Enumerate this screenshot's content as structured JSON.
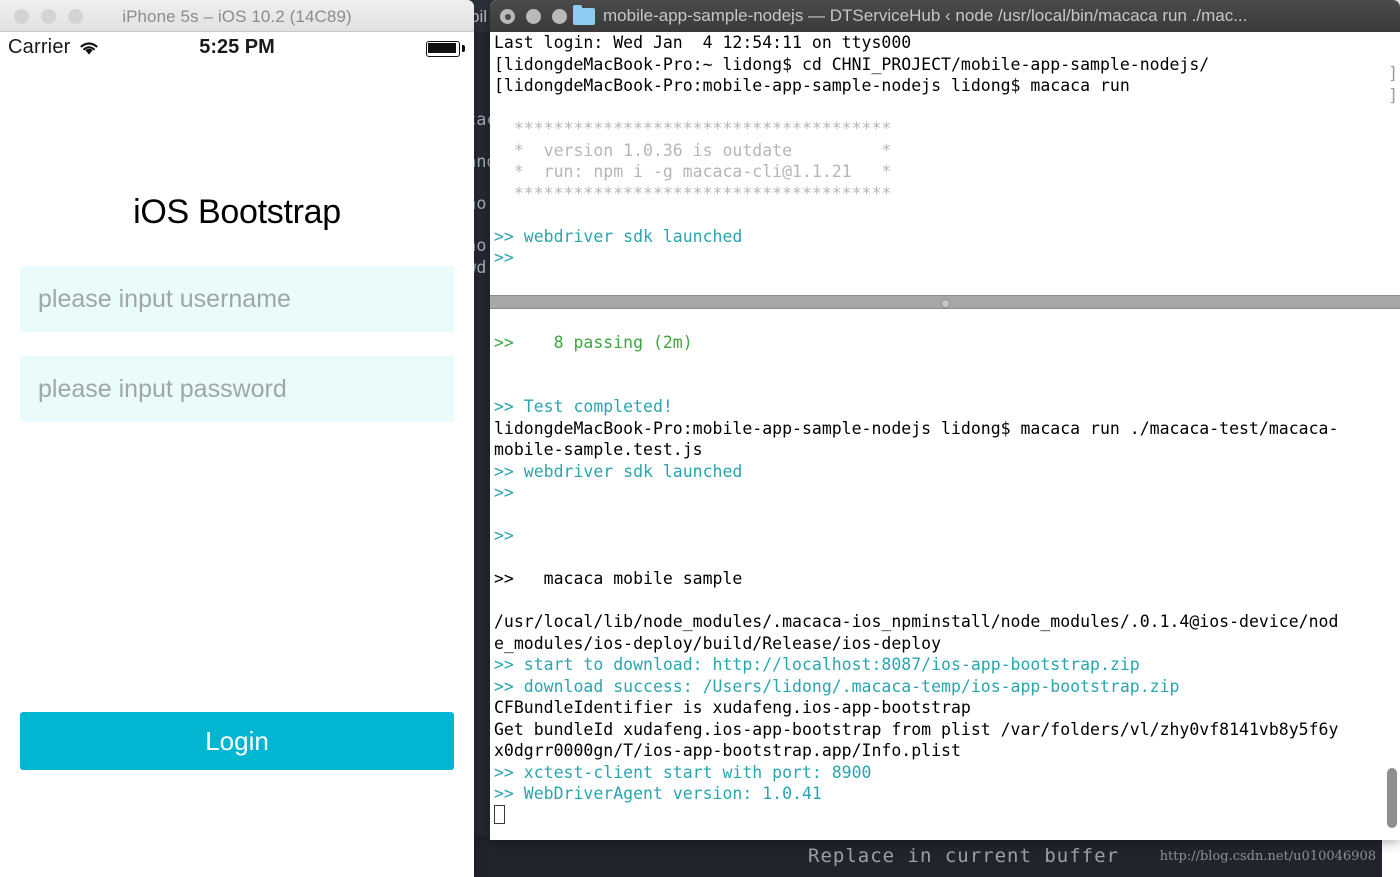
{
  "background_editor": {
    "title_fragment": "bil",
    "text_fragments": [
      "cac",
      "and",
      "no",
      "no",
      "wd"
    ],
    "status_text": "Replace in current buffer",
    "watermark": "http://blog.csdn.net/u010046908",
    "bg_color": "#272b33"
  },
  "simulator": {
    "window_title": "iPhone 5s – iOS 10.2 (14C89)",
    "traffic_lights": [
      "close-button",
      "minimize-button",
      "zoom-button"
    ],
    "status_bar": {
      "carrier": "Carrier",
      "wifi_icon": "wifi-icon",
      "time": "5:25 PM",
      "battery_icon": "battery-full-icon"
    },
    "app": {
      "title": "iOS Bootstrap",
      "username_placeholder": "please input username",
      "password_placeholder": "please input password",
      "username_value": "",
      "password_value": "",
      "login_label": "Login",
      "accent_color": "#00b6d1",
      "field_bg": "#e9fbfa"
    }
  },
  "terminal": {
    "window_title": "mobile-app-sample-nodejs — DTServiceHub ‹ node /usr/local/bin/macaca run ./mac...",
    "folder_icon": "folder-icon",
    "traffic_lights": [
      "close-button",
      "minimize-button",
      "zoom-button"
    ],
    "wrap_marks": [
      "]",
      "]"
    ],
    "top_pane": [
      {
        "text": "Last login: Wed Jan  4 12:54:11 on ttys000",
        "color": "black"
      },
      {
        "text": "[lidongdeMacBook-Pro:~ lidong$ cd CHNI_PROJECT/mobile-app-sample-nodejs/",
        "color": "black"
      },
      {
        "text": "[lidongdeMacBook-Pro:mobile-app-sample-nodejs lidong$ macaca run",
        "color": "black"
      },
      {
        "text": "",
        "color": "black"
      },
      {
        "text": "  **************************************",
        "color": "gray"
      },
      {
        "text": "  *  version 1.0.36 is outdate         *",
        "color": "gray"
      },
      {
        "text": "  *  run: npm i -g macaca-cli@1.1.21   *",
        "color": "gray"
      },
      {
        "text": "  **************************************",
        "color": "gray"
      },
      {
        "text": "",
        "color": "black"
      },
      {
        "text": ">> webdriver sdk launched",
        "color": "teal"
      },
      {
        "text": ">>",
        "color": "teal"
      }
    ],
    "bottom_pane": [
      {
        "text": "",
        "color": "black"
      },
      {
        "text": ">>    8 passing (2m)",
        "color": "green"
      },
      {
        "text": "",
        "color": "black"
      },
      {
        "text": "",
        "color": "black"
      },
      {
        "text": ">> Test completed!",
        "color": "teal"
      },
      {
        "text": "lidongdeMacBook-Pro:mobile-app-sample-nodejs lidong$ macaca run ./macaca-test/macaca-",
        "color": "black"
      },
      {
        "text": "mobile-sample.test.js",
        "color": "black"
      },
      {
        "text": ">> webdriver sdk launched",
        "color": "teal"
      },
      {
        "text": ">>",
        "color": "teal"
      },
      {
        "text": "",
        "color": "black"
      },
      {
        "text": ">>",
        "color": "teal"
      },
      {
        "text": "",
        "color": "black"
      },
      {
        "text": ">>   macaca mobile sample",
        "color": "black"
      },
      {
        "text": "",
        "color": "black"
      },
      {
        "text": "/usr/local/lib/node_modules/.macaca-ios_npminstall/node_modules/.0.1.4@ios-device/nod",
        "color": "black"
      },
      {
        "text": "e_modules/ios-deploy/build/Release/ios-deploy",
        "color": "black"
      },
      {
        "text": ">> start to download: http://localhost:8087/ios-app-bootstrap.zip",
        "color": "teal"
      },
      {
        "text": ">> download success: /Users/lidong/.macaca-temp/ios-app-bootstrap.zip",
        "color": "teal"
      },
      {
        "text": "CFBundleIdentifier is xudafeng.ios-app-bootstrap",
        "color": "black"
      },
      {
        "text": "Get bundleId xudafeng.ios-app-bootstrap from plist /var/folders/vl/zhy0vf8141vb8y5f6y",
        "color": "black"
      },
      {
        "text": "x0dgrr0000gn/T/ios-app-bootstrap.app/Info.plist",
        "color": "black"
      },
      {
        "text": ">> xctest-client start with port: 8900",
        "color": "teal"
      },
      {
        "text": ">> WebDriverAgent version: 1.0.41",
        "color": "teal"
      }
    ],
    "colors": {
      "teal": "#2aa5ae",
      "green": "#3fa63f",
      "gray": "#b6b6b6",
      "black": "#000000"
    }
  }
}
